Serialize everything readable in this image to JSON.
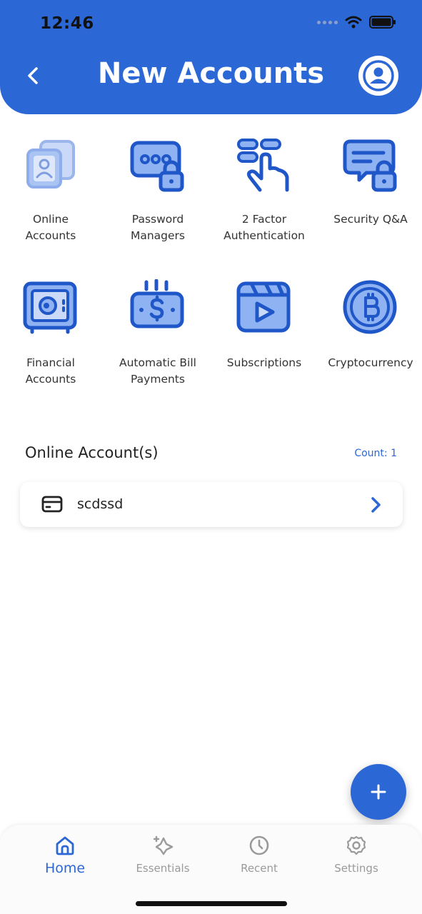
{
  "status_bar": {
    "time": "12:46"
  },
  "header": {
    "title": "New Accounts"
  },
  "categories": [
    {
      "label": "Online\nAccounts",
      "icon": "online-accounts-icon"
    },
    {
      "label": "Password\nManagers",
      "icon": "password-managers-icon"
    },
    {
      "label": "2 Factor\nAuthentication",
      "icon": "two-factor-icon"
    },
    {
      "label": "Security Q&A",
      "icon": "security-qa-icon"
    },
    {
      "label": "Financial\nAccounts",
      "icon": "vault-icon"
    },
    {
      "label": "Automatic Bill\nPayments",
      "icon": "bill-payment-icon"
    },
    {
      "label": "Subscriptions",
      "icon": "subscriptions-icon"
    },
    {
      "label": "Cryptocurrency",
      "icon": "bitcoin-icon"
    }
  ],
  "section": {
    "title": "Online Account(s)",
    "count": "Count: 1"
  },
  "accounts": [
    {
      "name": "scdssd"
    }
  ],
  "tabs": [
    {
      "label": "Home",
      "active": true
    },
    {
      "label": "Essentials",
      "active": false
    },
    {
      "label": "Recent",
      "active": false
    },
    {
      "label": "Settings",
      "active": false
    }
  ],
  "colors": {
    "primary": "#2c67d6",
    "icon_fill": "#8fb2f2",
    "icon_stroke": "#1f56c8"
  }
}
